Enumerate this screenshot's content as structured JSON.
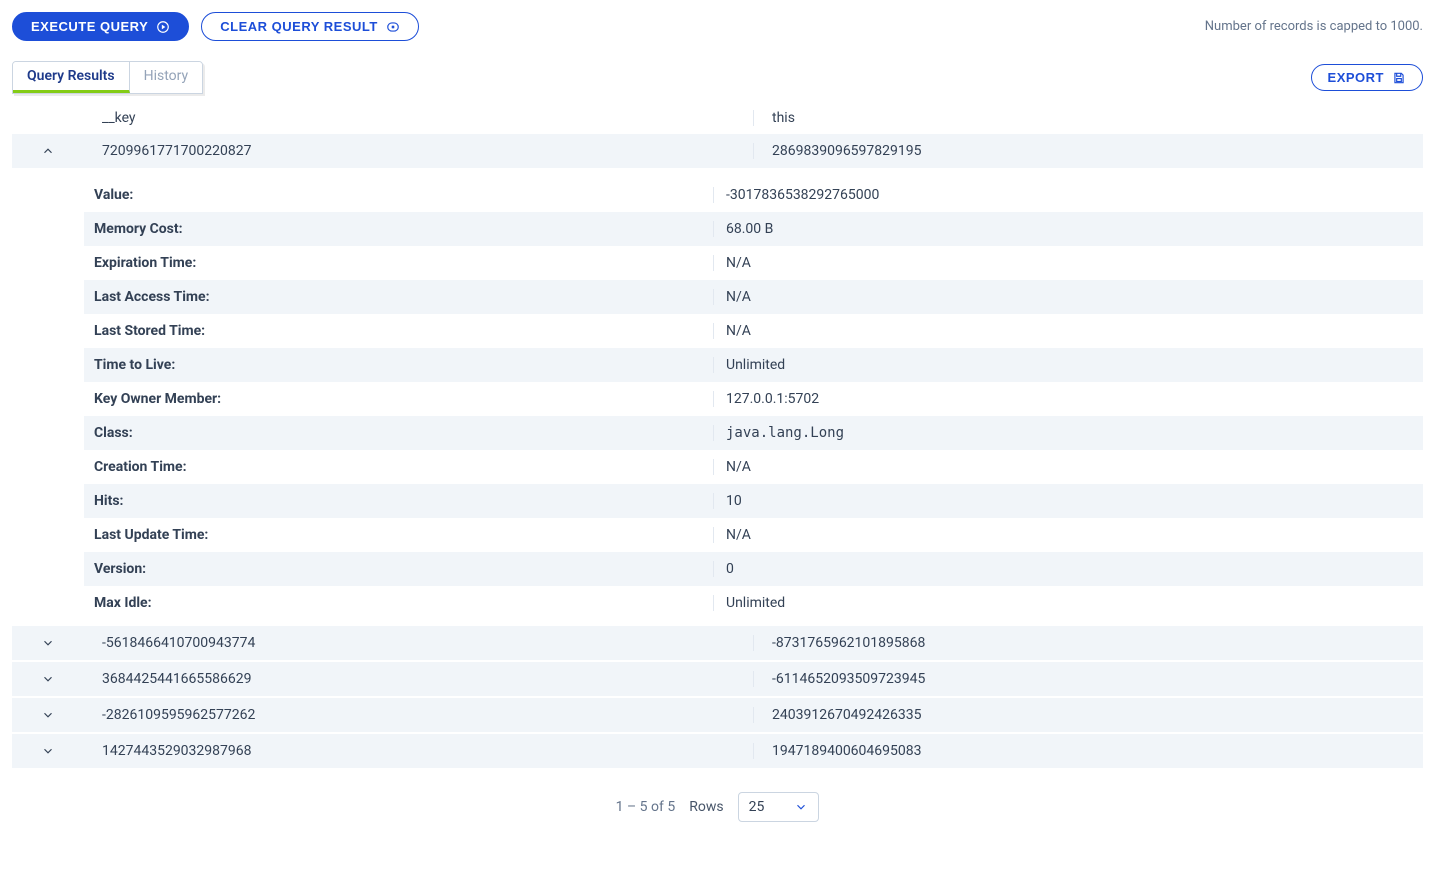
{
  "toolbar": {
    "execute_label": "EXECUTE QUERY",
    "clear_label": "CLEAR QUERY RESULT",
    "export_label": "EXPORT",
    "cap_text": "Number of records is capped to 1000."
  },
  "tabs": {
    "results": "Query Results",
    "history": "History"
  },
  "headers": {
    "key": "__key",
    "this": "this"
  },
  "rows": [
    {
      "key": "7209961771700220827",
      "this": "2869839096597829195"
    },
    {
      "key": "-5618466410700943774",
      "this": "-8731765962101895868"
    },
    {
      "key": "3684425441665586629",
      "this": "-6114652093509723945"
    },
    {
      "key": "-2826109595962577262",
      "this": "2403912670492426335"
    },
    {
      "key": "1427443529032987968",
      "this": "1947189400604695083"
    }
  ],
  "details": [
    {
      "label": "Value:",
      "value": "-3017836538292765000"
    },
    {
      "label": "Memory Cost:",
      "value": "68.00 B"
    },
    {
      "label": "Expiration Time:",
      "value": "N/A"
    },
    {
      "label": "Last Access Time:",
      "value": "N/A"
    },
    {
      "label": "Last Stored Time:",
      "value": "N/A"
    },
    {
      "label": "Time to Live:",
      "value": "Unlimited"
    },
    {
      "label": "Key Owner Member:",
      "value": "127.0.0.1:5702"
    },
    {
      "label": "Class:",
      "value": "java.lang.Long",
      "mono": true
    },
    {
      "label": "Creation Time:",
      "value": "N/A"
    },
    {
      "label": "Hits:",
      "value": "10"
    },
    {
      "label": "Last Update Time:",
      "value": "N/A"
    },
    {
      "label": "Version:",
      "value": "0"
    },
    {
      "label": "Max Idle:",
      "value": "Unlimited"
    }
  ],
  "footer": {
    "range": "1 – 5 of 5",
    "rows_label": "Rows",
    "rows_value": "25"
  }
}
